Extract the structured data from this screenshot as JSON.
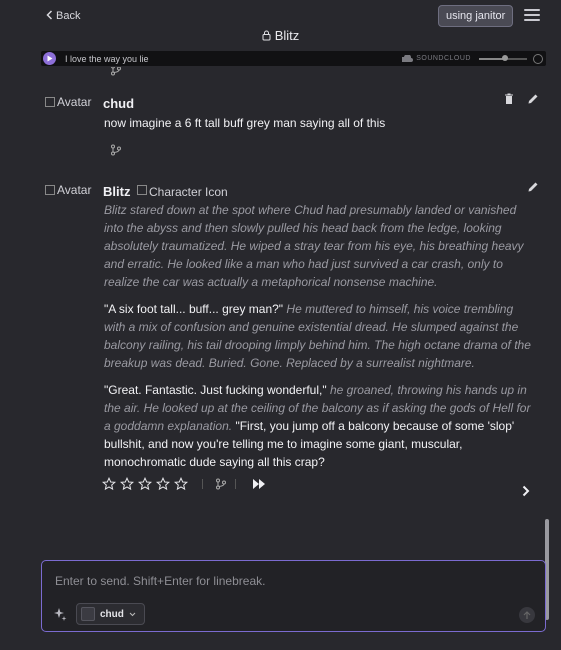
{
  "header": {
    "back_label": "Back",
    "janitor_label": "using janitor",
    "title": "Blitz"
  },
  "player": {
    "track": "I love the way you lie",
    "brand": "SOUNDCLOUD",
    "volume": 0.55
  },
  "messages": [
    {
      "avatar_alt": "Avatar",
      "name": "chud",
      "text": "now imagine a 6 ft tall buff grey man saying all of this"
    },
    {
      "avatar_alt": "Avatar",
      "name": "Blitz",
      "char_icon_alt": "Character Icon",
      "paragraphs": [
        [
          {
            "i": true,
            "t": "Blitz stared down at the spot where Chud had presumably landed or vanished into the abyss and then slowly pulled his head back from the ledge, looking absolutely traumatized. He wiped a stray tear from his eye, his breathing heavy and erratic. He looked like a man who had just survived a car crash, only to realize the car was actually a metaphorical nonsense machine."
          }
        ],
        [
          {
            "i": false,
            "t": "\"A six foot tall... buff... grey man?\""
          },
          {
            "i": true,
            "t": " He muttered to himself, his voice trembling with a mix of confusion and genuine existential dread. He slumped against the balcony railing, his tail drooping limply behind him. The high octane drama of the breakup was dead. Buried. Gone. Replaced by a surrealist nightmare."
          }
        ],
        [
          {
            "i": false,
            "t": "\"Great. Fantastic. Just fucking wonderful,\""
          },
          {
            "i": true,
            "t": " he groaned, throwing his hands up in the air. He looked up at the ceiling of the balcony as if asking the gods of Hell for a goddamn explanation. "
          },
          {
            "i": false,
            "t": "\"First, you jump off a balcony because of some 'slop' bullshit, and now you're telling me to imagine some giant, muscular, monochromatic dude saying all this crap?"
          }
        ]
      ],
      "rating": 0,
      "stars_max": 5
    }
  ],
  "composer": {
    "placeholder": "Enter to send. Shift+Enter for linebreak.",
    "persona_name": "chud"
  },
  "colors": {
    "background": "#28282d",
    "accent": "#8d6fd8",
    "composer_border": "#7b6bd0"
  }
}
